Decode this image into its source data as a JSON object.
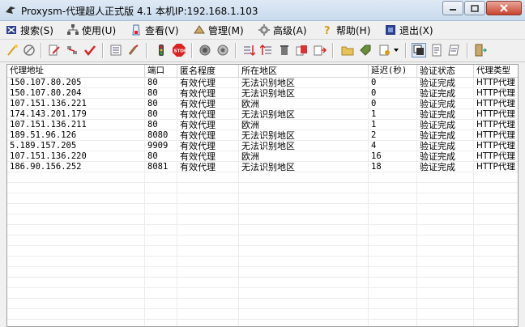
{
  "window": {
    "title": "Proxysm-代理超人正式版 4.1  本机IP:192.168.1.103"
  },
  "menu": [
    {
      "label": "搜索(S)",
      "icon": "search-icon"
    },
    {
      "label": "使用(U)",
      "icon": "network-icon"
    },
    {
      "label": "查看(V)",
      "icon": "view-icon"
    },
    {
      "label": "管理(M)",
      "icon": "manage-icon"
    },
    {
      "label": "高级(A)",
      "icon": "gear-icon"
    },
    {
      "label": "帮助(H)",
      "icon": "help-icon"
    },
    {
      "label": "退出(X)",
      "icon": "exit-icon"
    }
  ],
  "table": {
    "columns": [
      "代理地址",
      "端口",
      "匿名程度",
      "所在地区",
      "延迟(秒)",
      "验证状态",
      "代理类型"
    ],
    "rows": [
      [
        "150.107.80.205",
        "80",
        "有效代理",
        "无法识别地区",
        "0",
        "验证完成",
        "HTTP代理"
      ],
      [
        "150.107.80.204",
        "80",
        "有效代理",
        "无法识别地区",
        "0",
        "验证完成",
        "HTTP代理"
      ],
      [
        "107.151.136.221",
        "80",
        "有效代理",
        "欧洲",
        "0",
        "验证完成",
        "HTTP代理"
      ],
      [
        "174.143.201.179",
        "80",
        "有效代理",
        "无法识别地区",
        "1",
        "验证完成",
        "HTTP代理"
      ],
      [
        "107.151.136.211",
        "80",
        "有效代理",
        "欧洲",
        "1",
        "验证完成",
        "HTTP代理"
      ],
      [
        "189.51.96.126",
        "8080",
        "有效代理",
        "无法识别地区",
        "2",
        "验证完成",
        "HTTP代理"
      ],
      [
        "5.189.157.205",
        "9909",
        "有效代理",
        "无法识别地区",
        "4",
        "验证完成",
        "HTTP代理"
      ],
      [
        "107.151.136.220",
        "80",
        "有效代理",
        "欧洲",
        "16",
        "验证完成",
        "HTTP代理"
      ],
      [
        "186.90.156.252",
        "8081",
        "有效代理",
        "无法识别地区",
        "18",
        "验证完成",
        "HTTP代理"
      ]
    ]
  },
  "colors": {
    "titlebar": "#c9dbee",
    "close_button": "#c7432e",
    "window_bg": "#f0f0f0"
  }
}
